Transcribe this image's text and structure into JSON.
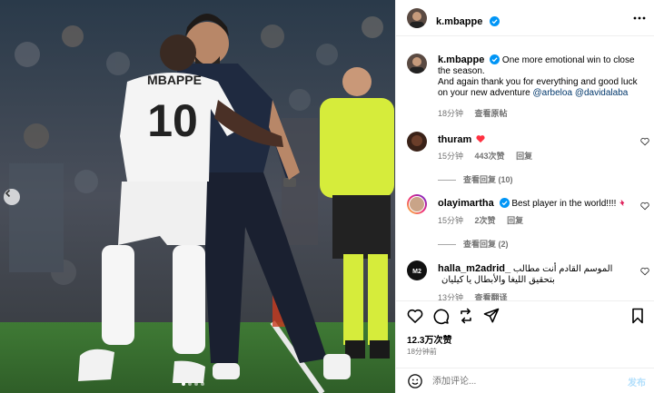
{
  "post": {
    "username": "k.mbappe",
    "caption": "One more emotional win to close the season.\nAnd again thank you for everything and good luck on your new adventure",
    "caption_mention_1": "@arbeloa",
    "caption_mention_2": "@davidalaba",
    "caption_time": "18分钟",
    "caption_translate": "查看原帖",
    "likes": "12.3万次赞",
    "posted_time": "18分钟前",
    "jersey_name": "MBAPPE",
    "jersey_number": "10"
  },
  "comments": [
    {
      "username": "thuram",
      "text": "",
      "emoji": "heart",
      "time": "15分钟",
      "likes": "443次赞",
      "reply": "回复",
      "view_replies": "查看回复 (10)"
    },
    {
      "username": "olayimartha",
      "text": "Best player in the world!!!!",
      "emoji": "pin",
      "time": "15分钟",
      "likes": "2次赞",
      "reply": "回复",
      "view_replies": "查看回复 (2)"
    },
    {
      "username": "halla_m2adrid_",
      "text": "الموسم القادم أنت مطالب بتحقيق الليغا والأبطال يا كيليان",
      "time": "13分钟",
      "likes": "",
      "reply": "查看翻译"
    }
  ],
  "comment_box": {
    "placeholder": "添加评论...",
    "post_label": "发布"
  },
  "colors": {
    "mention": "#00376b",
    "verified": "#0095f6",
    "heart": "#ff3040",
    "post_disabled": "#b2dffc"
  },
  "icons": [
    "more-icon",
    "heart-icon",
    "comment-icon",
    "share-icon",
    "send-icon",
    "bookmark-icon",
    "emoji-icon",
    "verified-icon",
    "carousel-prev-icon"
  ]
}
